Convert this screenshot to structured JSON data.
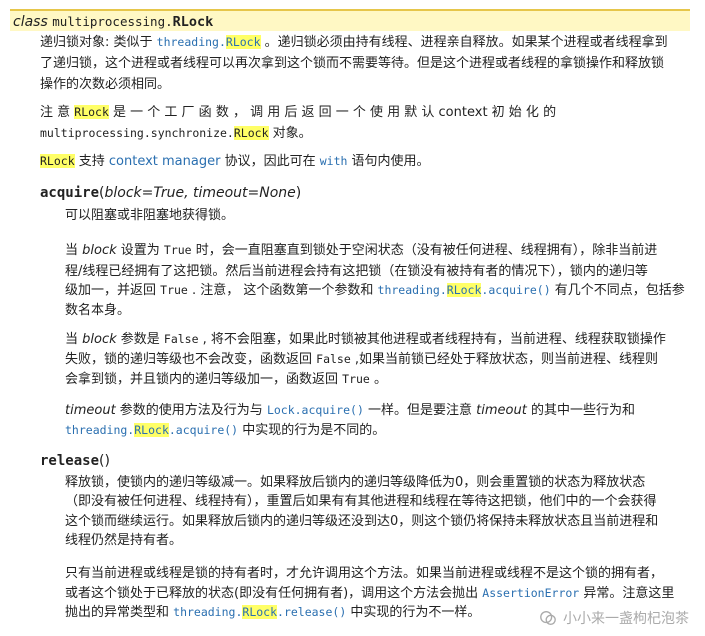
{
  "signature": {
    "keyword": "class",
    "module": "multiprocessing.",
    "name": "RLock"
  },
  "desc": {
    "l1": {
      "a": "递归锁对象: 类似于 ",
      "code_mod": "threading.",
      "code_cls": "RLock",
      "b": " 。递归锁必须由持有线程、进程亲自释放。如果某个进程或者线程拿到"
    },
    "l2": "了递归锁，这个进程或者线程可以再次拿到这个锁而不需要等待。但是这个进程或者线程的拿锁操作和释放锁",
    "l3": "操作的次数必须相同。"
  },
  "note": {
    "l1": {
      "a": "注  意 ",
      "cls": "RLock",
      "b": " 是 一 个 工 厂 函 数 ， 调 用 后 返 回 一 个 使 用 默 认  context 初 始 化 的"
    },
    "l2": {
      "code": "multiprocessing.synchronize.",
      "cls": "RLock",
      "b": " 对象。"
    }
  },
  "ctx": {
    "cls": "RLock",
    "a": " 支持 ",
    "link": "context manager",
    "b": " 协议，因此可在 ",
    "with": "with",
    "c": " 语句内使用。"
  },
  "acquire": {
    "name": "acquire",
    "params": "block=True, timeout=None",
    "p1": "可以阻塞或非阻塞地获得锁。",
    "p2": {
      "l1": {
        "a": "当 ",
        "block": "block",
        "b": " 设置为 ",
        "true": "True",
        "c": " 时，会一直阻塞直到锁处于空闲状态（没有被任何进程、线程拥有），除非当前进"
      },
      "l2": "程/线程已经拥有了这把锁。然后当前进程会持有这把锁（在锁没有被持有者的情况下），锁内的递归等",
      "l3": {
        "a": "级加一，并返回 ",
        "true": "True",
        "b": " . 注意， 这个函数第一个参数和 ",
        "code_mod": "threading.",
        "cls": "RLock",
        "code_m": ".acquire()",
        "c": " 有几个不同点，包括参"
      },
      "l4": "数名本身。"
    },
    "p3": {
      "l1": {
        "a": "当 ",
        "block": "block",
        "b": " 参数是 ",
        "false": "False",
        "c": " , 将不会阻塞，如果此时锁被其他进程或者线程持有，当前进程、线程获取锁操作"
      },
      "l2": {
        "a": "失败，锁的递归等级也不会改变，函数返回 ",
        "false": "False",
        "b": " ,如果当前锁已经处于释放状态，则当前进程、线程则"
      },
      "l3": {
        "a": "会拿到锁，并且锁内的递归等级加一，函数返回 ",
        "true": "True",
        "b": " 。"
      }
    },
    "p4": {
      "l1": {
        "timeout": "timeout",
        "a": " 参数的使用方法及行为与 ",
        "code": "Lock.acquire()",
        "b": " 一样。但是要注意 ",
        "timeout2": "timeout",
        "c": " 的其中一些行为和"
      },
      "l2": {
        "code_mod": "threading.",
        "cls": "RLock",
        "code_m": ".acquire()",
        "a": " 中实现的行为是不同的。"
      }
    }
  },
  "release": {
    "name": "release",
    "params": "",
    "p1": {
      "l1": "释放锁，使锁内的递归等级减一。如果释放后锁内的递归等级降低为0，则会重置锁的状态为释放状态",
      "l2": "（即没有被任何进程、线程持有），重置后如果有有其他进程和线程在等待这把锁，他们中的一个会获得",
      "l3": "这个锁而继续运行。如果释放后锁内的递归等级还没到达0，则这个锁仍将保持未释放状态且当前进程和",
      "l4": "线程仍然是持有者。"
    },
    "p2": {
      "l1": "只有当前进程或线程是锁的持有者时，才允许调用这个方法。如果当前进程或线程不是这个锁的拥有者，",
      "l2": {
        "a": "或者这个锁处于已释放的状态(即没有任何拥有者)，调用这个方法会抛出 ",
        "err": "AssertionError",
        "b": " 异常。注意这里"
      },
      "l3": {
        "a": "抛出的异常类型和 ",
        "code_mod": "threading.",
        "cls": "RLock",
        "code_m": ".release()",
        "b": " 中实现的行为不一样。"
      }
    }
  },
  "watermark": "小小来一盏枸杞泡茶"
}
